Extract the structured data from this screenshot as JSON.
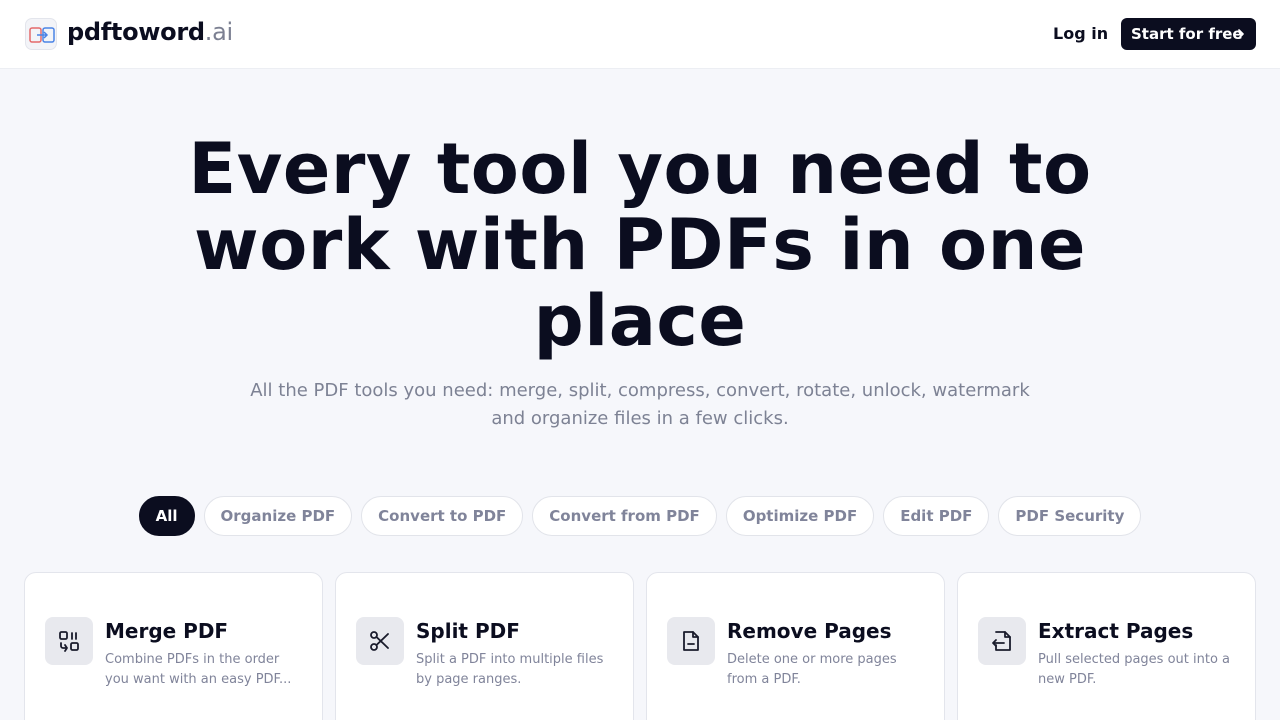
{
  "header": {
    "brand_main": "pdftoword",
    "brand_suffix": ".ai",
    "login_label": "Log in",
    "start_label": "Start for free"
  },
  "hero": {
    "title": "Every tool you need to work with PDFs in one place",
    "subtitle": "All the PDF tools you need: merge, split, compress, convert, rotate, unlock, watermark and organize files in a few clicks."
  },
  "filters": [
    {
      "label": "All",
      "active": true
    },
    {
      "label": "Organize PDF",
      "active": false
    },
    {
      "label": "Convert to PDF",
      "active": false
    },
    {
      "label": "Convert from PDF",
      "active": false
    },
    {
      "label": "Optimize PDF",
      "active": false
    },
    {
      "label": "Edit PDF",
      "active": false
    },
    {
      "label": "PDF Security",
      "active": false
    }
  ],
  "tools": [
    {
      "title": "Merge PDF",
      "description": "Combine PDFs in the order you want with an easy PDF...",
      "icon": "merge-icon"
    },
    {
      "title": "Split PDF",
      "description": "Split a PDF into multiple files by page ranges.",
      "icon": "scissors-icon"
    },
    {
      "title": "Remove Pages",
      "description": "Delete one or more pages from a PDF.",
      "icon": "remove-page-icon"
    },
    {
      "title": "Extract Pages",
      "description": "Pull selected pages out into a new PDF.",
      "icon": "extract-page-icon"
    }
  ],
  "colors": {
    "primary": "#0b0d1f",
    "background": "#f6f7fb",
    "muted_text": "#7d8294",
    "icon_bg": "#e8e9ee"
  }
}
